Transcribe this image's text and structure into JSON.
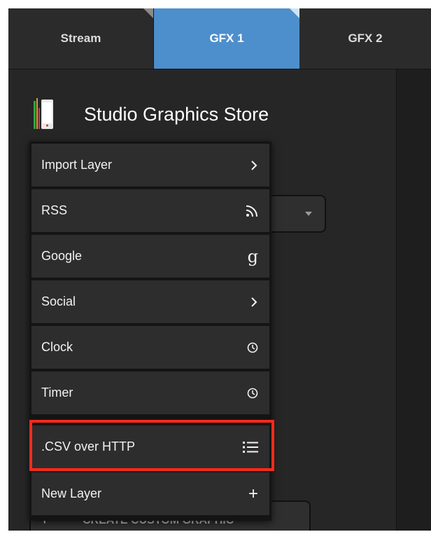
{
  "tabs": [
    {
      "label": "Stream"
    },
    {
      "label": "GFX 1"
    },
    {
      "label": "GFX 2"
    }
  ],
  "store": {
    "title": "Studio Graphics Store"
  },
  "menu": {
    "items": [
      {
        "label": "Import Layer",
        "icon": "chevron-right-icon"
      },
      {
        "label": "RSS",
        "icon": "rss-icon"
      },
      {
        "label": "Google",
        "icon": "google-icon"
      },
      {
        "label": "Social",
        "icon": "chevron-right-icon"
      },
      {
        "label": "Clock",
        "icon": "clock-icon"
      },
      {
        "label": "Timer",
        "icon": "clock-icon"
      },
      {
        "label": ".CSV over HTTP",
        "icon": "list-icon"
      },
      {
        "label": "New Layer",
        "icon": "plus-icon"
      }
    ]
  },
  "create_button": {
    "label": "CREATE CUSTOM GRAPHIC"
  },
  "colors": {
    "active_tab": "#4d8fcc",
    "highlight": "#ff2a1a",
    "background": "#262626"
  }
}
